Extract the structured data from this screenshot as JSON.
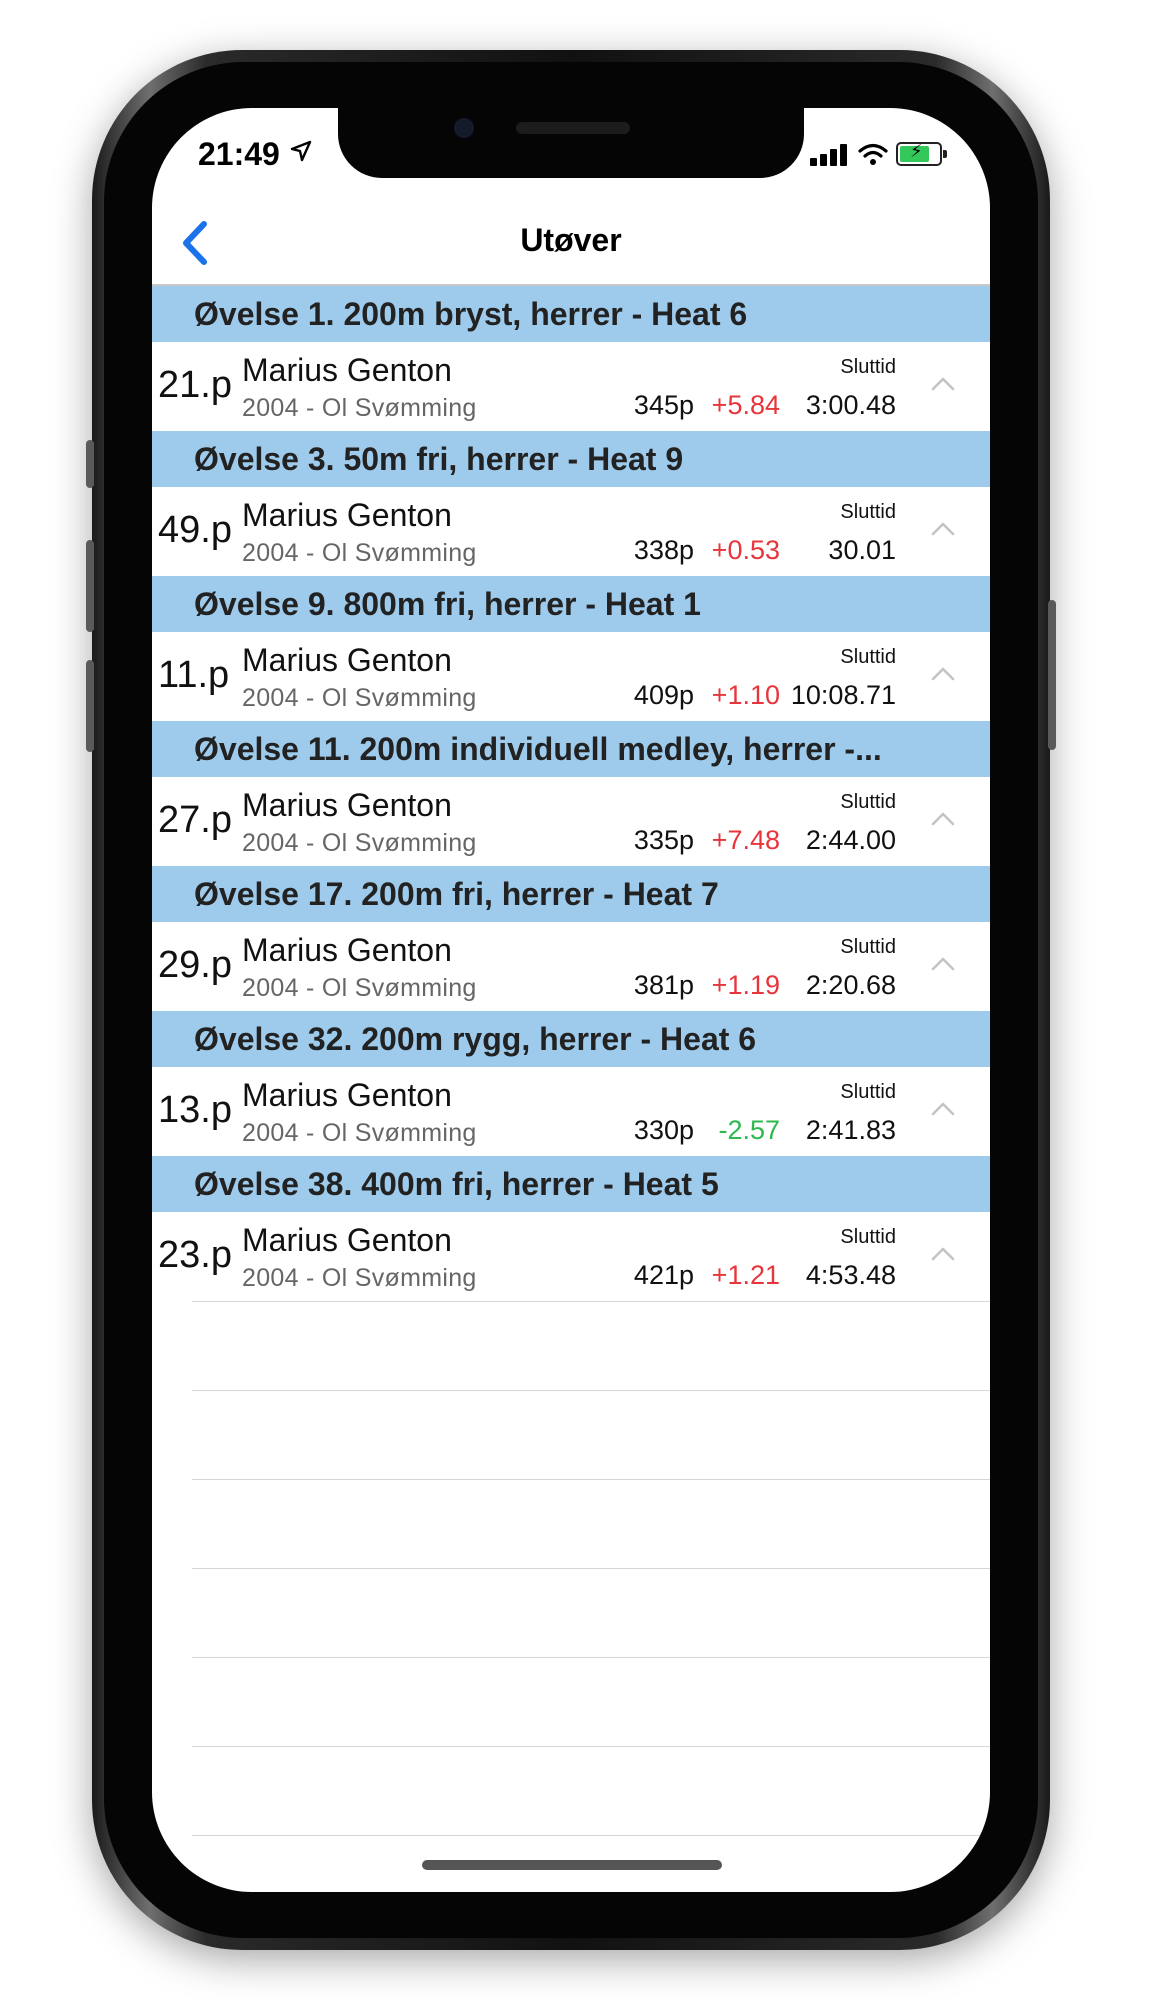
{
  "status_bar": {
    "time": "21:49",
    "location_icon": "location-arrow-icon",
    "signal_icon": "cellular-signal-icon",
    "wifi_icon": "wifi-icon",
    "battery_icon": "battery-charging-icon",
    "battery_level": 0.8
  },
  "nav": {
    "back_icon": "chevron-left-icon",
    "title": "Utøver"
  },
  "colors": {
    "section_bg": "#9ecbec",
    "accent": "#1a73e8",
    "diff_positive": "#e8343b",
    "diff_negative": "#2db84d"
  },
  "results_label": "Sluttid",
  "sections": [
    {
      "title": "Øvelse 1. 200m bryst, herrer - Heat 6",
      "result": {
        "place": "21.p",
        "name": "Marius Genton",
        "subtitle": "2004 - Ol Svømming",
        "points": "345p",
        "diff": "+5.84",
        "diff_sign": "positive",
        "time": "3:00.48"
      }
    },
    {
      "title": "Øvelse 3. 50m fri, herrer - Heat 9",
      "result": {
        "place": "49.p",
        "name": "Marius Genton",
        "subtitle": "2004 - Ol Svømming",
        "points": "338p",
        "diff": "+0.53",
        "diff_sign": "positive",
        "time": "30.01"
      }
    },
    {
      "title": "Øvelse 9. 800m fri, herrer - Heat 1",
      "result": {
        "place": "11.p",
        "name": "Marius Genton",
        "subtitle": "2004 - Ol Svømming",
        "points": "409p",
        "diff": "+1.10",
        "diff_sign": "positive",
        "time": "10:08.71"
      }
    },
    {
      "title": "Øvelse 11. 200m individuell medley, herrer -...",
      "result": {
        "place": "27.p",
        "name": "Marius Genton",
        "subtitle": "2004 - Ol Svømming",
        "points": "335p",
        "diff": "+7.48",
        "diff_sign": "positive",
        "time": "2:44.00"
      }
    },
    {
      "title": "Øvelse 17. 200m fri, herrer - Heat 7",
      "result": {
        "place": "29.p",
        "name": "Marius Genton",
        "subtitle": "2004 - Ol Svømming",
        "points": "381p",
        "diff": "+1.19",
        "diff_sign": "positive",
        "time": "2:20.68"
      }
    },
    {
      "title": "Øvelse 32. 200m rygg, herrer - Heat 6",
      "result": {
        "place": "13.p",
        "name": "Marius Genton",
        "subtitle": "2004 - Ol Svømming",
        "points": "330p",
        "diff": "-2.57",
        "diff_sign": "negative",
        "time": "2:41.83"
      }
    },
    {
      "title": "Øvelse 38. 400m fri, herrer - Heat 5",
      "result": {
        "place": "23.p",
        "name": "Marius Genton",
        "subtitle": "2004 - Ol Svømming",
        "points": "421p",
        "diff": "+1.21",
        "diff_sign": "positive",
        "time": "4:53.48"
      }
    }
  ]
}
